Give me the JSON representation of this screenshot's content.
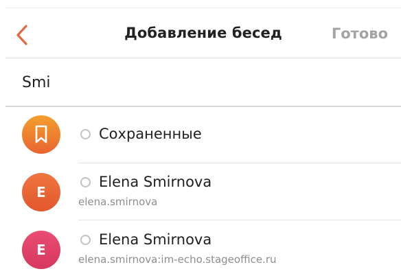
{
  "header": {
    "title": "Добавление бесед",
    "done_label": "Готово",
    "back_icon": "chevron-left-icon",
    "accent_color": "#e4693f"
  },
  "search": {
    "value": "Smi"
  },
  "chats": [
    {
      "name": "Сохраненные",
      "subtitle": "",
      "avatar_icon": "bookmark-icon",
      "avatar_colors": [
        "#f39a2c",
        "#e7652f"
      ],
      "selected": false
    },
    {
      "name": "Elena Smirnova",
      "subtitle": "elena.smirnova",
      "avatar_letter": "E",
      "avatar_colors": [
        "#ee6f3c",
        "#e55a2e"
      ],
      "selected": false
    },
    {
      "name": "Elena Smirnova",
      "subtitle": "elena.smirnova:im-echo.stageoffice.ru",
      "avatar_letter": "E",
      "avatar_colors": [
        "#e8476f",
        "#d93a62"
      ],
      "selected": false
    }
  ]
}
